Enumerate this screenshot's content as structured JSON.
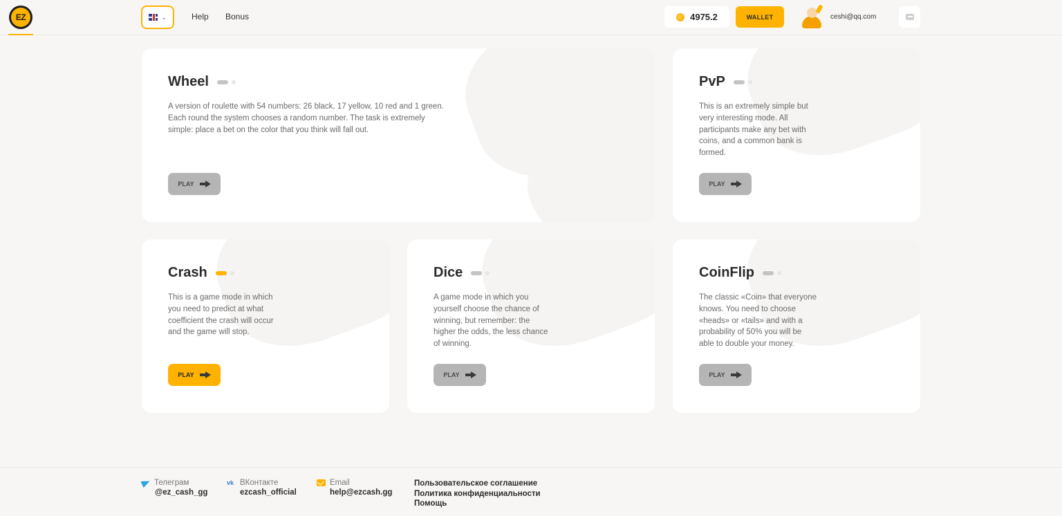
{
  "header": {
    "nav": [
      {
        "label": "Help"
      },
      {
        "label": "Bonus"
      }
    ],
    "balance": "4975.2",
    "wallet_label": "WALLET",
    "user_email": "ceshi@qq.com",
    "logo_text": "EZ"
  },
  "games": [
    {
      "title": "Wheel",
      "description_lines": [
        "A version of roulette with 54 numbers: 26 black, 17 yellow, 10 red and 1 green.",
        "Each round the system chooses a random number. The task is extremely",
        "simple: place a bet on the color that you think will fall out."
      ],
      "play_label": "PLAY"
    },
    {
      "title": "PvP",
      "description_lines": [
        "This is an extremely simple but",
        "very interesting mode. All",
        "participants make any bet with",
        "coins, and a common bank is",
        "formed."
      ],
      "play_label": "PLAY"
    },
    {
      "title": "Crash",
      "description_lines": [
        "This is a game mode in which",
        "you need to predict at what",
        "coefficient the crash will occur",
        "and the game will stop."
      ],
      "play_label": "PLAY"
    },
    {
      "title": "Dice",
      "description_lines": [
        "A game mode in which you",
        "yourself choose the chance of",
        "winning, but remember: the",
        "higher the odds, the less chance",
        "of winning."
      ],
      "play_label": "PLAY"
    },
    {
      "title": "CoinFlip",
      "description_lines": [
        "The classic «Coin» that everyone",
        "knows. You need to choose",
        "«heads» or «tails» and with a",
        "probability of 50% you will be",
        "able to double your money."
      ],
      "play_label": "PLAY"
    }
  ],
  "footer": {
    "contacts": [
      {
        "label": "Телеграм",
        "value": "@ez_cash_gg",
        "icon": "telegram-icon"
      },
      {
        "label": "ВКонтакте",
        "value": "ezcash_official",
        "icon": "vk-icon"
      },
      {
        "label": "Email",
        "value": "help@ezcash.gg",
        "icon": "mail-icon"
      }
    ],
    "links": [
      "Пользовательское соглашение",
      "Политика конфиденциальности",
      "Помощь"
    ]
  },
  "colors": {
    "accent": "#ffb300",
    "background": "#f7f6f4",
    "card": "#ffffff",
    "button_inactive": "#b5b5b5"
  }
}
